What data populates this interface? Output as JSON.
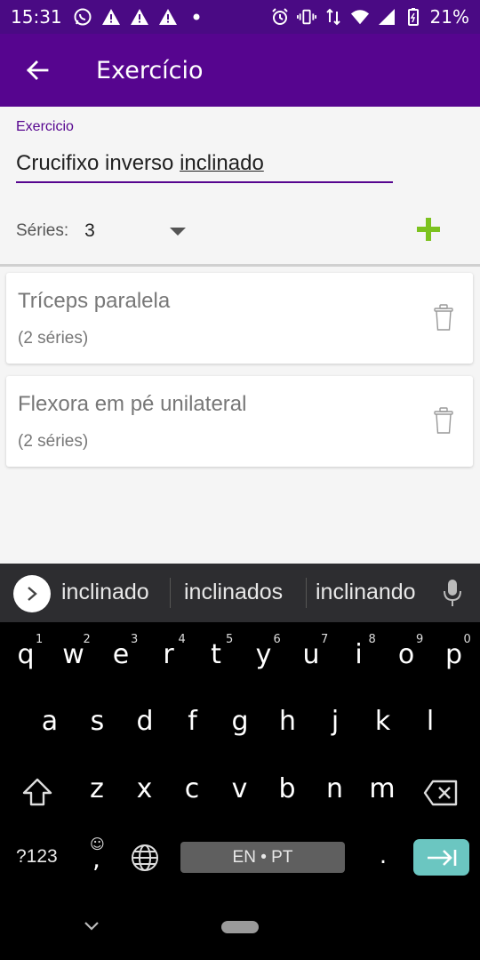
{
  "status_bar": {
    "time": "15:31",
    "battery": "21%"
  },
  "app_bar": {
    "title": "Exercício"
  },
  "form": {
    "label": "Exercicio",
    "value": "Crucifixo inverso inclinado",
    "value_plain": "Crucifixo inverso ",
    "value_underlined": "inclinado",
    "series_label": "Séries:",
    "series_value": "3"
  },
  "exercises": [
    {
      "name": "Tríceps paralela",
      "detail": "(2 séries)"
    },
    {
      "name": "Flexora em pé unilateral",
      "detail": "(2 séries)"
    }
  ],
  "keyboard": {
    "suggestions": [
      "inclinado",
      "inclinados",
      "inclinando"
    ],
    "row1": [
      "q",
      "w",
      "e",
      "r",
      "t",
      "y",
      "u",
      "i",
      "o",
      "p"
    ],
    "row1_hints": [
      "1",
      "2",
      "3",
      "4",
      "5",
      "6",
      "7",
      "8",
      "9",
      "0"
    ],
    "row2": [
      "a",
      "s",
      "d",
      "f",
      "g",
      "h",
      "j",
      "k",
      "l"
    ],
    "row3": [
      "z",
      "x",
      "c",
      "v",
      "b",
      "n",
      "m"
    ],
    "symbols_label": "?123",
    "comma": ",",
    "period": ".",
    "space_label": "EN • PT"
  },
  "colors": {
    "primary": "#56058f",
    "status": "#4a0a84",
    "accent_add": "#7cc21f",
    "enter": "#6bc6c1"
  }
}
